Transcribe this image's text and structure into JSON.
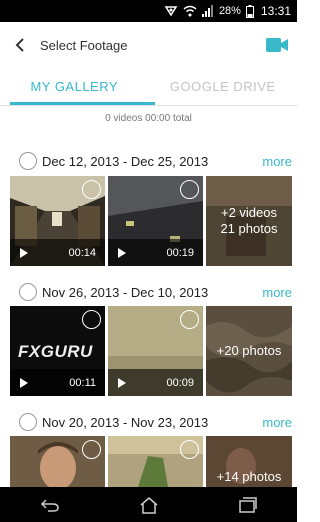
{
  "status_bar": {
    "battery": "28%",
    "time": "13:31"
  },
  "app_bar": {
    "title": "Select Footage"
  },
  "tabs": [
    {
      "label": "MY GALLERY",
      "active": true
    },
    {
      "label": "GOOGLE DRIVE",
      "active": false
    }
  ],
  "summary": "0 videos 00:00 total",
  "sections": [
    {
      "date_range": "Dec 12, 2013 - Dec 25, 2013",
      "more": "more",
      "thumbs": [
        {
          "duration": "00:14"
        },
        {
          "duration": "00:19"
        },
        {
          "overlay_line1": "+2 videos",
          "overlay_line2": "21 photos"
        }
      ]
    },
    {
      "date_range": "Nov 26, 2013 - Dec 10, 2013",
      "more": "more",
      "thumbs": [
        {
          "duration": "00:11",
          "logo_text": "FXGURU"
        },
        {
          "duration": "00:09"
        },
        {
          "overlay_line1": "+20 photos"
        }
      ]
    },
    {
      "date_range": "Nov 20, 2013 - Nov 23, 2013",
      "more": "more",
      "thumbs": [
        {},
        {},
        {
          "overlay_line1": "+14 photos"
        }
      ]
    }
  ],
  "colors": {
    "accent": "#38b8c8",
    "status_bar": "#000000"
  },
  "icons": {
    "back": "back-arrow-icon",
    "camera": "video-camera-icon",
    "nav": [
      "back-icon",
      "home-icon",
      "recent-apps-icon"
    ]
  }
}
